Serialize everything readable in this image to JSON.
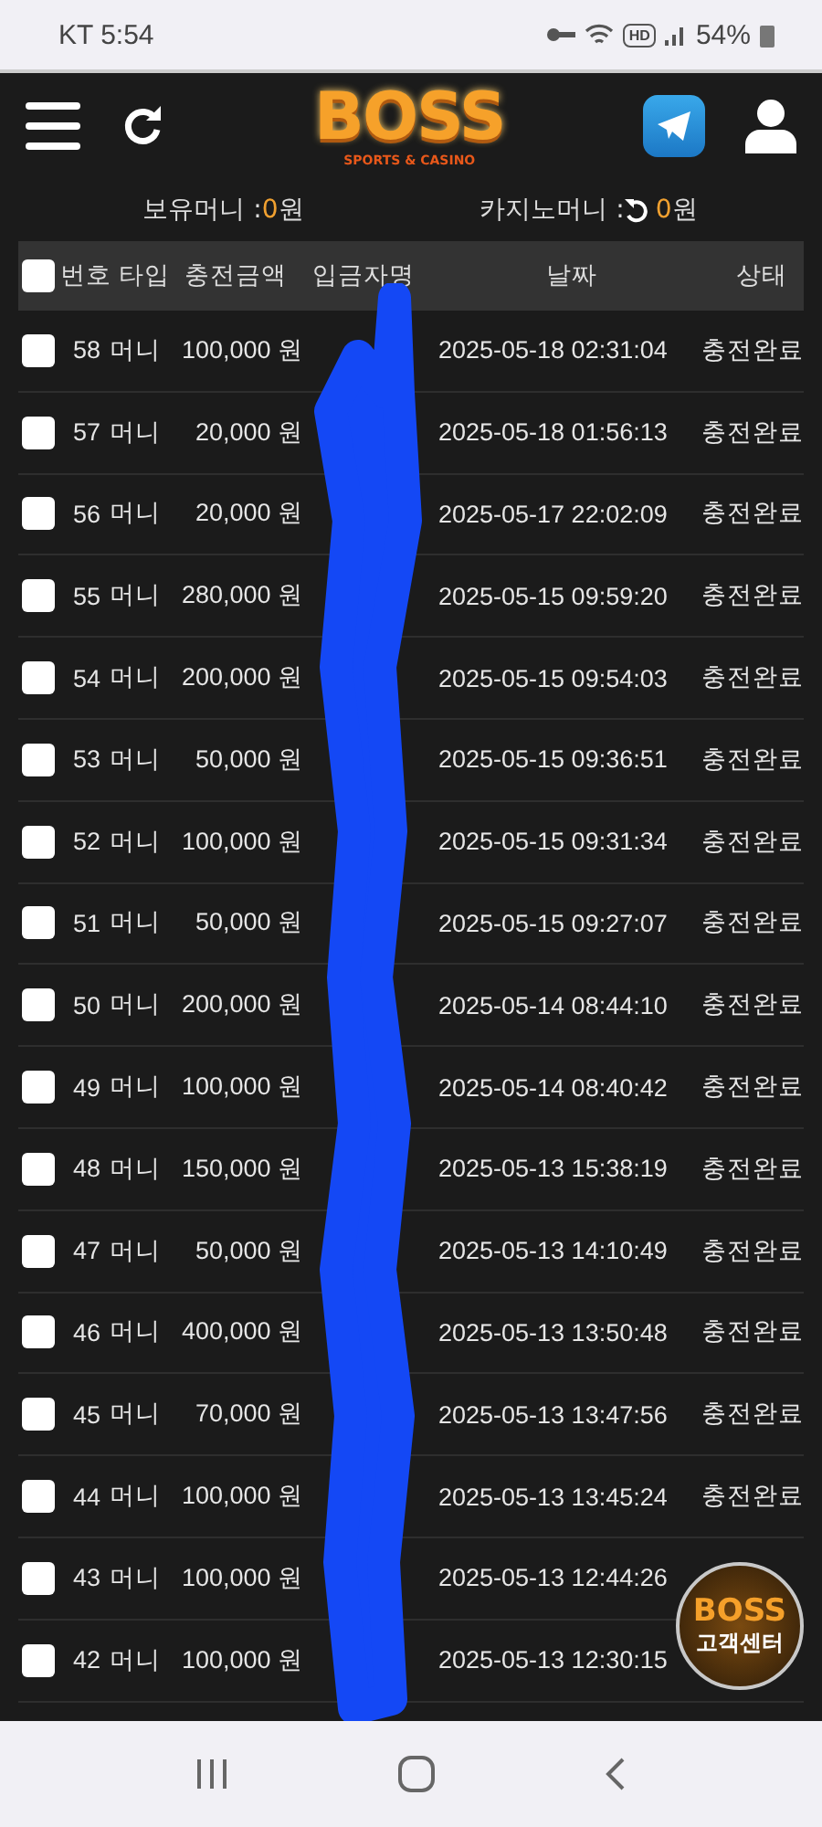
{
  "status_bar": {
    "carrier_time": "KT 5:54",
    "hd": "HD",
    "battery": "54%"
  },
  "header": {
    "logo": "BOSS",
    "logo_sub": "SPORTS & CASINO"
  },
  "balances": [
    {
      "label": "보유머니 : ",
      "amount": "0",
      "unit": " 원",
      "refresh": false
    },
    {
      "label": "카지노머니 : ",
      "amount": "0",
      "unit": " 원",
      "refresh": true
    }
  ],
  "table": {
    "select_all": {
      "checked": false
    },
    "columns": [
      "번호",
      "타입",
      "충전금액",
      "입금자명",
      "날짜",
      "상태"
    ],
    "rows": [
      {
        "checked": false,
        "no": "58",
        "type": "머니",
        "amount": "100,000 원",
        "date": "2025-05-18 02:31:04",
        "status": "충전완료"
      },
      {
        "checked": false,
        "no": "57",
        "type": "머니",
        "amount": "20,000 원",
        "date": "2025-05-18 01:56:13",
        "status": "충전완료"
      },
      {
        "checked": false,
        "no": "56",
        "type": "머니",
        "amount": "20,000 원",
        "date": "2025-05-17 22:02:09",
        "status": "충전완료"
      },
      {
        "checked": false,
        "no": "55",
        "type": "머니",
        "amount": "280,000 원",
        "date": "2025-05-15 09:59:20",
        "status": "충전완료"
      },
      {
        "checked": false,
        "no": "54",
        "type": "머니",
        "amount": "200,000 원",
        "date": "2025-05-15 09:54:03",
        "status": "충전완료"
      },
      {
        "checked": false,
        "no": "53",
        "type": "머니",
        "amount": "50,000 원",
        "date": "2025-05-15 09:36:51",
        "status": "충전완료"
      },
      {
        "checked": false,
        "no": "52",
        "type": "머니",
        "amount": "100,000 원",
        "date": "2025-05-15 09:31:34",
        "status": "충전완료"
      },
      {
        "checked": false,
        "no": "51",
        "type": "머니",
        "amount": "50,000 원",
        "date": "2025-05-15 09:27:07",
        "status": "충전완료"
      },
      {
        "checked": false,
        "no": "50",
        "type": "머니",
        "amount": "200,000 원",
        "date": "2025-05-14 08:44:10",
        "status": "충전완료"
      },
      {
        "checked": false,
        "no": "49",
        "type": "머니",
        "amount": "100,000 원",
        "date": "2025-05-14 08:40:42",
        "status": "충전완료"
      },
      {
        "checked": false,
        "no": "48",
        "type": "머니",
        "amount": "150,000 원",
        "date": "2025-05-13 15:38:19",
        "status": "충전완료"
      },
      {
        "checked": false,
        "no": "47",
        "type": "머니",
        "amount": "50,000 원",
        "date": "2025-05-13 14:10:49",
        "status": "충전완료"
      },
      {
        "checked": false,
        "no": "46",
        "type": "머니",
        "amount": "400,000 원",
        "date": "2025-05-13 13:50:48",
        "status": "충전완료"
      },
      {
        "checked": false,
        "no": "45",
        "type": "머니",
        "amount": "70,000 원",
        "date": "2025-05-13 13:47:56",
        "status": "충전완료"
      },
      {
        "checked": false,
        "no": "44",
        "type": "머니",
        "amount": "100,000 원",
        "date": "2025-05-13 13:45:24",
        "status": "충전완료"
      },
      {
        "checked": false,
        "no": "43",
        "type": "머니",
        "amount": "100,000 원",
        "date": "2025-05-13 12:44:26"
      },
      {
        "checked": false,
        "no": "42",
        "type": "머니",
        "amount": "100,000 원",
        "date": "2025-05-13 12:30:15"
      }
    ]
  },
  "support_badge": {
    "logo": "BOSS",
    "label": "고객센터"
  }
}
